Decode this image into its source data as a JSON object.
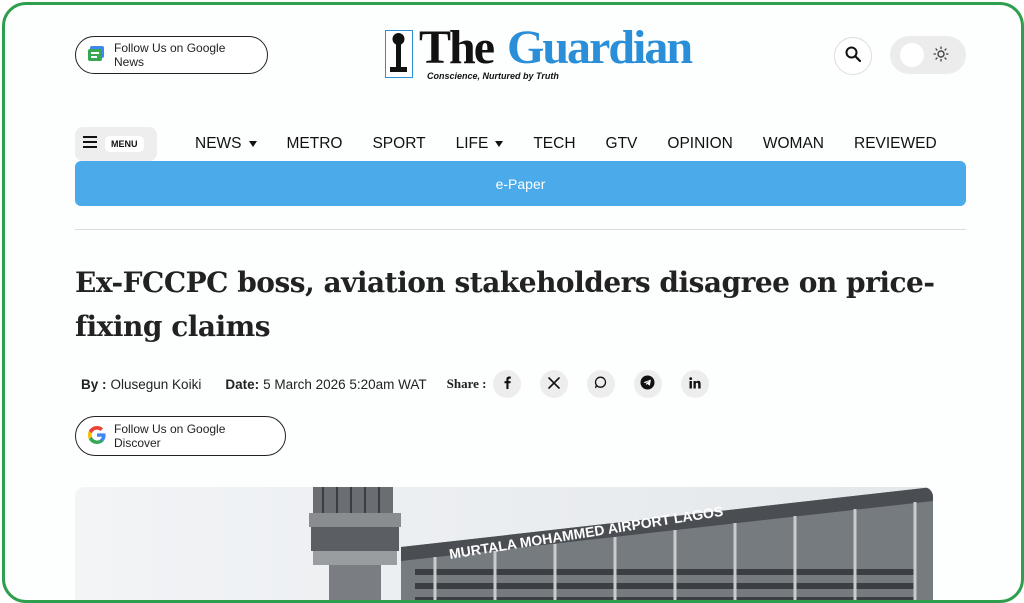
{
  "header": {
    "google_news_label": "Follow Us on Google News",
    "logo": {
      "word1": "The",
      "word2": "Guardian",
      "tagline": "Conscience, Nurtured by Truth"
    },
    "search_icon": "search-icon",
    "theme_toggle_icon": "sun-icon"
  },
  "nav": {
    "menu_label": "MENU",
    "items": [
      {
        "label": "NEWS",
        "dropdown": true
      },
      {
        "label": "METRO",
        "dropdown": false
      },
      {
        "label": "SPORT",
        "dropdown": false
      },
      {
        "label": "LIFE",
        "dropdown": true
      },
      {
        "label": "TECH",
        "dropdown": false
      },
      {
        "label": "GTV",
        "dropdown": false
      },
      {
        "label": "OPINION",
        "dropdown": false
      },
      {
        "label": "WOMAN",
        "dropdown": false
      },
      {
        "label": "REVIEWED",
        "dropdown": false
      }
    ],
    "epaper_label": "e-Paper"
  },
  "article": {
    "headline": "Ex-FCCPC boss, aviation stakeholders disagree on price-fixing claims",
    "by_label": "By :",
    "author": "Olusegun Koiki",
    "date_label": "Date:",
    "date": "5 March 2026 5:20am WAT",
    "share_label": "Share :",
    "share_icons": [
      "facebook-icon",
      "x-icon",
      "whatsapp-icon",
      "telegram-icon",
      "linkedin-icon"
    ],
    "google_discover_label": "Follow Us on Google Discover",
    "hero_sign_text": "MURTALA MOHAMMED AIRPORT LAGOS"
  },
  "colors": {
    "brand_blue": "#2a8fd8",
    "epaper_blue": "#4aaaea",
    "frame_green": "#2e9e4f"
  }
}
